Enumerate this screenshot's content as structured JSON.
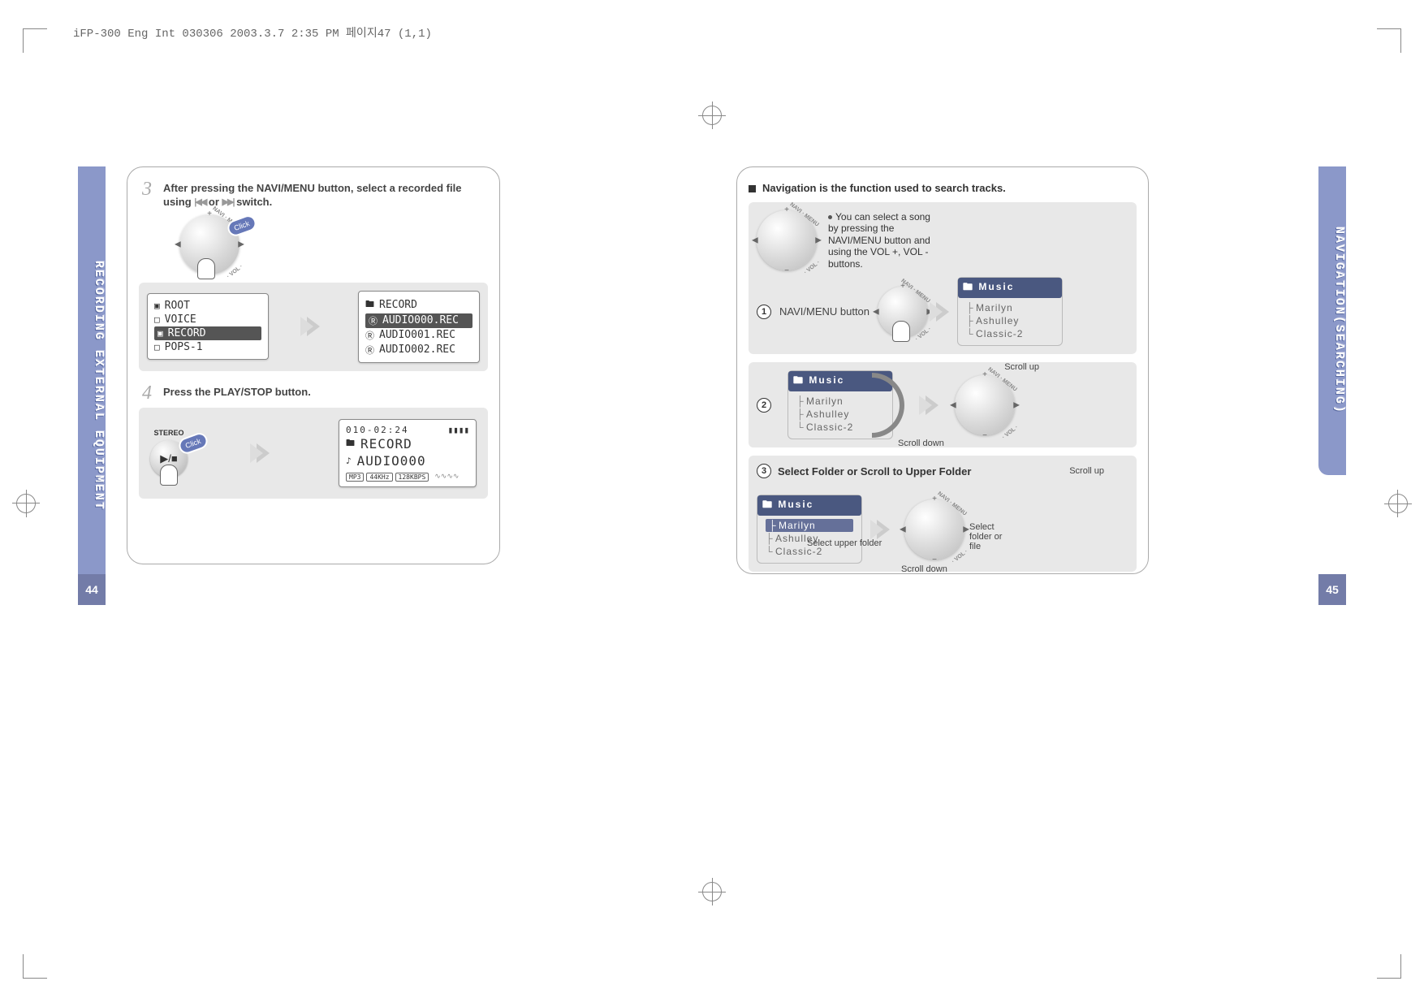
{
  "meta": {
    "header": "iFP-300 Eng Int 030306  2003.3.7 2:35 PM  페이지47 (1,1)"
  },
  "left_page": {
    "tab_title": "RECORDING EXTERNAL EQUIPMENT",
    "page_number": "44",
    "step3": {
      "num": "3",
      "text_a": "After pressing the NAVI/MENU button, select a recorded file using ",
      "text_b": " or ",
      "text_c": " switch.",
      "click": "Click",
      "lcd1": {
        "r1": "ROOT",
        "r2": "VOICE",
        "r3": "RECORD",
        "r4": "POPS-1"
      },
      "lcd2": {
        "r1": "RECORD",
        "r2": "AUDIO000.REC",
        "r3": "AUDIO001.REC",
        "r4": "AUDIO002.REC"
      }
    },
    "step4": {
      "num": "4",
      "text": "Press the PLAY/STOP button.",
      "click": "Click",
      "stereo": "STEREO",
      "lcd": {
        "time": "010-02:24",
        "folder": "RECORD",
        "file": "AUDIO000",
        "b1": "MP3",
        "b2": "44KHz",
        "b3": "128KBPS"
      }
    }
  },
  "right_page": {
    "tab_title": "NAVIGATION(SEARCHING)",
    "page_number": "45",
    "headline": "Navigation is the function used to search tracks.",
    "note": "You can select a song by pressing the NAVI/MENU button and using the VOL +, VOL - buttons.",
    "step1": {
      "num": "1",
      "label": "NAVI/MENU button"
    },
    "music": {
      "title": "Music",
      "i1": "Marilyn",
      "i2": "Ashulley",
      "i3": "Classic-2"
    },
    "step2": {
      "num": "2",
      "scroll_up": "Scroll up",
      "scroll_down": "Scroll down"
    },
    "step3": {
      "num": "3",
      "title": "Select Folder or Scroll to Upper Folder",
      "scroll_up": "Scroll up",
      "scroll_down": "Scroll down",
      "sel_upper": "Select upper folder",
      "sel_folder": "Select folder or file"
    },
    "dial": {
      "navi": "NAVI · MENU",
      "vol": "· VOL ·"
    }
  }
}
